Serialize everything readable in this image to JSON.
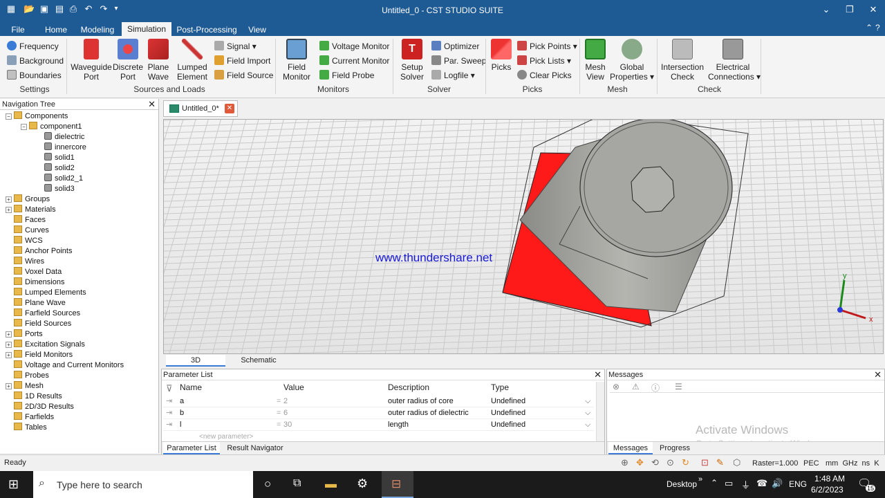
{
  "window": {
    "title": "Untitled_0 - CST STUDIO SUITE",
    "controls": {
      "minimize": "⌄",
      "restore": "❐",
      "close": "✕"
    }
  },
  "menu_tabs": [
    "File",
    "Home",
    "Modeling",
    "Simulation",
    "Post-Processing",
    "View"
  ],
  "ribbon": {
    "settings": {
      "items": [
        "Frequency",
        "Background",
        "Boundaries"
      ],
      "label": "Settings"
    },
    "sources": {
      "big": [
        "Waveguide\nPort",
        "Discrete\nPort",
        "Plane\nWave",
        "Lumped\nElement"
      ],
      "small": [
        "Signal ▾",
        "Field Import",
        "Field Source"
      ],
      "label": "Sources and Loads"
    },
    "monitors": {
      "big": [
        "Field\nMonitor"
      ],
      "small": [
        "Voltage Monitor",
        "Current Monitor",
        "Field Probe"
      ],
      "label": "Monitors"
    },
    "solver": {
      "big": [
        "Setup\nSolver"
      ],
      "small": [
        "Optimizer",
        "Par. Sweep",
        "Logfile ▾"
      ],
      "label": "Solver"
    },
    "picks": {
      "big": [
        "Picks"
      ],
      "small": [
        "Pick Points ▾",
        "Pick Lists ▾",
        "Clear Picks"
      ],
      "label": "Picks"
    },
    "mesh": {
      "big": [
        "Mesh\nView",
        "Global\nProperties ▾"
      ],
      "label": "Mesh"
    },
    "check": {
      "big": [
        "Intersection\nCheck",
        "Electrical\nConnections ▾"
      ],
      "label": "Check"
    }
  },
  "nav_tree": {
    "title": "Navigation Tree",
    "items": [
      {
        "label": "Components",
        "level": 0,
        "exp": "−",
        "icon": "folder"
      },
      {
        "label": "component1",
        "level": 1,
        "exp": "−",
        "icon": "component"
      },
      {
        "label": "dielectric",
        "level": 2,
        "exp": "",
        "icon": "solid"
      },
      {
        "label": "innercore",
        "level": 2,
        "exp": "",
        "icon": "solid"
      },
      {
        "label": "solid1",
        "level": 2,
        "exp": "",
        "icon": "solid"
      },
      {
        "label": "solid2",
        "level": 2,
        "exp": "",
        "icon": "solid"
      },
      {
        "label": "solid2_1",
        "level": 2,
        "exp": "",
        "icon": "solid"
      },
      {
        "label": "solid3",
        "level": 2,
        "exp": "",
        "icon": "solid"
      },
      {
        "label": "Groups",
        "level": 0,
        "exp": "+",
        "icon": "folder"
      },
      {
        "label": "Materials",
        "level": 0,
        "exp": "+",
        "icon": "folder"
      },
      {
        "label": "Faces",
        "level": 0,
        "exp": "",
        "icon": "folder"
      },
      {
        "label": "Curves",
        "level": 0,
        "exp": "",
        "icon": "folder"
      },
      {
        "label": "WCS",
        "level": 0,
        "exp": "",
        "icon": "folder"
      },
      {
        "label": "Anchor Points",
        "level": 0,
        "exp": "",
        "icon": "folder"
      },
      {
        "label": "Wires",
        "level": 0,
        "exp": "",
        "icon": "folder"
      },
      {
        "label": "Voxel Data",
        "level": 0,
        "exp": "",
        "icon": "folder"
      },
      {
        "label": "Dimensions",
        "level": 0,
        "exp": "",
        "icon": "folder"
      },
      {
        "label": "Lumped Elements",
        "level": 0,
        "exp": "",
        "icon": "folder"
      },
      {
        "label": "Plane Wave",
        "level": 0,
        "exp": "",
        "icon": "folder"
      },
      {
        "label": "Farfield Sources",
        "level": 0,
        "exp": "",
        "icon": "folder"
      },
      {
        "label": "Field Sources",
        "level": 0,
        "exp": "",
        "icon": "folder"
      },
      {
        "label": "Ports",
        "level": 0,
        "exp": "+",
        "icon": "folder"
      },
      {
        "label": "Excitation Signals",
        "level": 0,
        "exp": "+",
        "icon": "folder"
      },
      {
        "label": "Field Monitors",
        "level": 0,
        "exp": "+",
        "icon": "folder"
      },
      {
        "label": "Voltage and Current Monitors",
        "level": 0,
        "exp": "",
        "icon": "folder"
      },
      {
        "label": "Probes",
        "level": 0,
        "exp": "",
        "icon": "folder"
      },
      {
        "label": "Mesh",
        "level": 0,
        "exp": "+",
        "icon": "folder"
      },
      {
        "label": "1D Results",
        "level": 0,
        "exp": "",
        "icon": "folder"
      },
      {
        "label": "2D/3D Results",
        "level": 0,
        "exp": "",
        "icon": "folder"
      },
      {
        "label": "Farfields",
        "level": 0,
        "exp": "",
        "icon": "folder"
      },
      {
        "label": "Tables",
        "level": 0,
        "exp": "",
        "icon": "folder"
      }
    ]
  },
  "doc_tab": {
    "label": "Untitled_0*"
  },
  "viewport": {
    "watermark": "www.thundershare.net",
    "axis_labels": {
      "x": "x",
      "y": "y"
    }
  },
  "view_tabs": [
    "3D",
    "Schematic"
  ],
  "parameter_list": {
    "title": "Parameter List",
    "columns": [
      "Name",
      "Value",
      "Description",
      "Type"
    ],
    "rows": [
      {
        "name": "a",
        "eq": "=",
        "value": "2",
        "description": "outer radius of core",
        "type": "Undefined"
      },
      {
        "name": "b",
        "eq": "=",
        "value": "6",
        "description": "outer radius of dielectric",
        "type": "Undefined"
      },
      {
        "name": "l",
        "eq": "=",
        "value": "30",
        "description": "length",
        "type": "Undefined"
      }
    ],
    "new_parameter": "<new parameter>",
    "tabs": [
      "Parameter List",
      "Result Navigator"
    ]
  },
  "messages": {
    "title": "Messages",
    "tabs": [
      "Messages",
      "Progress"
    ],
    "activate_line1": "Activate Windows",
    "activate_line2": "Go to Settings to activate Windows."
  },
  "statusbar": {
    "left": "Ready",
    "raster": "Raster=1.000",
    "pec": "PEC",
    "units": "mm  GHz  ns  K"
  },
  "taskbar": {
    "search_placeholder": "Type here to search",
    "desktop": "Desktop",
    "lang": "ENG",
    "time": "1:48 AM",
    "date": "6/2/2023",
    "notif_count": "15"
  },
  "colors": {
    "title_blue": "#1e5a94",
    "pick_red": "#ff1a1a",
    "watermark": "#1a1adb"
  }
}
